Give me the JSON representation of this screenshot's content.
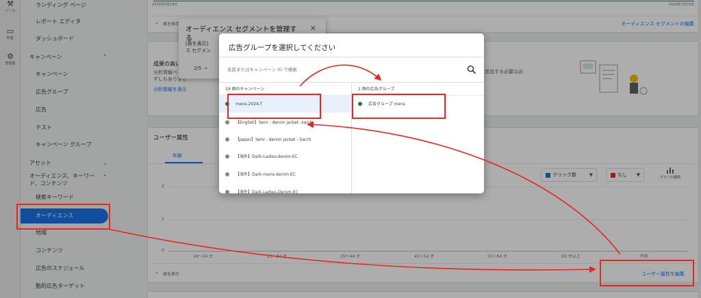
{
  "rail": {
    "tools": "ツール",
    "billing": "料金",
    "admin": "管理者"
  },
  "nav": {
    "landing": "ランディング ページ",
    "report_editor": "レポート エディタ",
    "dashboard": "ダッシュボード",
    "campaign_section": "キャンペーン",
    "campaigns": "キャンペーン",
    "ad_groups": "広告グループ",
    "ads": "広告",
    "tests": "テスト",
    "campaign_groups": "キャンペーン グループ",
    "assets": "アセット",
    "audience_section_line1": "オーディエンス、キーワー",
    "audience_section_line2": "ド、コンテンツ",
    "search_keywords": "検索キーワード",
    "audiences": "オーディエンス",
    "locations": "地域",
    "content": "コンテンツ",
    "ad_schedule": "広告のスケジュール",
    "dynamic_targets": "動的広告ターゲット"
  },
  "top_card": {
    "date_start": "2024年6月18日",
    "date_end": "2024年7月15日",
    "show_table": "表を表示",
    "edit_segments": "オーディエンス セグメントの編集"
  },
  "tooltip": {
    "title_line1": "オーディエンス セグメントを管理す",
    "title_line2": "る",
    "body_line1": "[表を表示]",
    "body_line2": "ス セグメン",
    "pager": "2/5"
  },
  "promo": {
    "title": "成果の高いオ",
    "line1": "分析情報ペー",
    "line2": "ずしもありませ",
    "link": "分析情報を表示",
    "right_text": "追加する必要は必"
  },
  "user_attr": {
    "title": "ユーザー属性",
    "tab_age": "年齢",
    "dd_clicks": "クリック数",
    "dd_none": "なし",
    "chart_type": "グラフの種類",
    "y_ticks": [
      "2",
      "1",
      "0"
    ],
    "x_labels": [
      "18〜24 才",
      "25〜34 才",
      "35〜44 才",
      "45〜54 才",
      "55〜64 才",
      "65 才以上",
      "不明"
    ],
    "show_table": "表を表示",
    "edit_link": "ユーザー属性を編集"
  },
  "modal": {
    "title": "広告グループを選択してください",
    "search_placeholder": "名前またはキャンペーン ID で検索",
    "left_header": "19 個のキャンペーン",
    "right_header": "1 個の広告グループ",
    "campaigns": [
      {
        "name": "mens-2024-T",
        "status": "enabled"
      },
      {
        "name": "【English】Yami - denim jacket -sarch",
        "status": "paused"
      },
      {
        "name": "【Japan】Yami - denim jacket - Sarch",
        "status": "paused"
      },
      {
        "name": "【海外】Dark-Ladies-denim-EC",
        "status": "paused"
      },
      {
        "name": "【海外】Dark-mens-denim-EC",
        "status": "paused"
      },
      {
        "name": "【海外】Dark-Ladies-Denim-EC",
        "status": "paused"
      }
    ],
    "ad_group": "広告グループ mens"
  },
  "colors": {
    "accent": "#1a73e8",
    "enabled": "#188038",
    "paused": "#80868b",
    "annotation": "#e8261c",
    "series1": "#1a73e8",
    "series2": "#d93025"
  }
}
